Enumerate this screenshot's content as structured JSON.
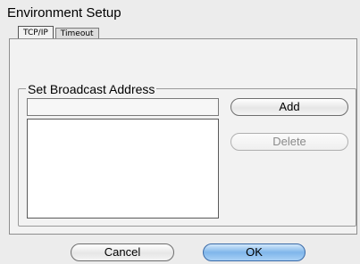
{
  "window": {
    "title": "Environment Setup"
  },
  "tabs": [
    {
      "label": "TCP/IP",
      "active": true
    },
    {
      "label": "Timeout",
      "active": false
    }
  ],
  "broadcast": {
    "group_label": "Set Broadcast Address",
    "address_value": "",
    "address_list": [],
    "add_label": "Add",
    "delete_label": "Delete",
    "delete_enabled": false
  },
  "footer": {
    "cancel_label": "Cancel",
    "ok_label": "OK"
  }
}
